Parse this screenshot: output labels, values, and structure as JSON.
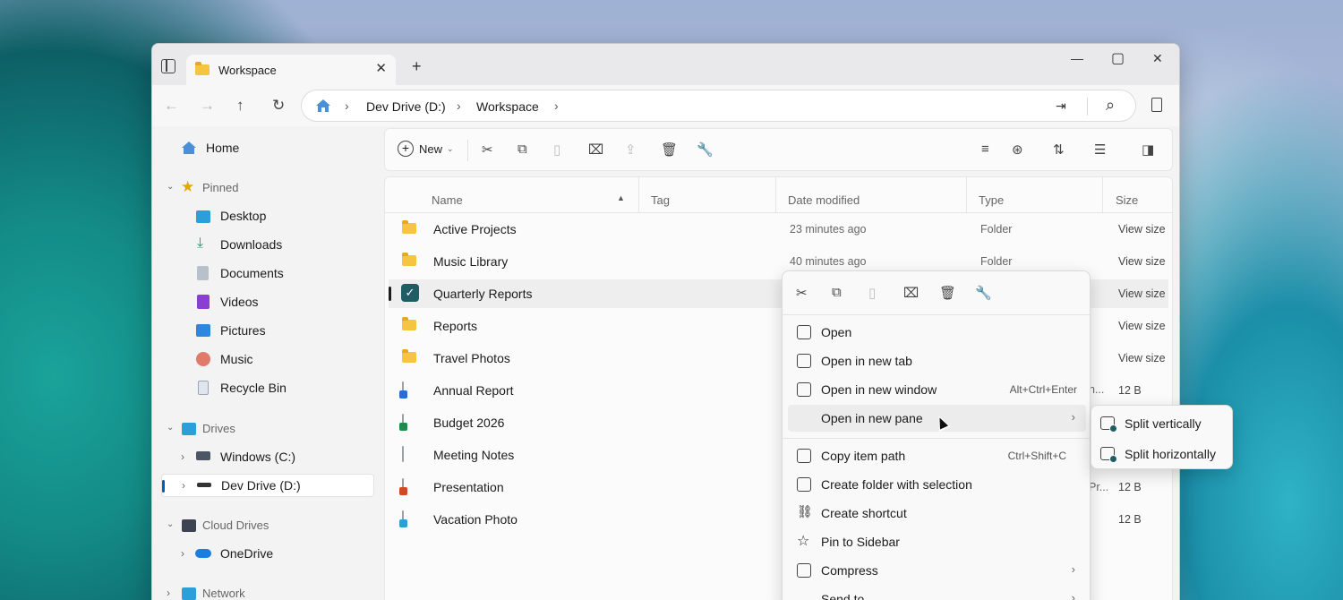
{
  "tab": {
    "title": "Workspace",
    "close": "✕",
    "new": "+"
  },
  "window_controls": {
    "minimize": "—",
    "maximize": "▢",
    "close": "✕"
  },
  "nav": {
    "back": "←",
    "forward": "→",
    "up": "↑",
    "refresh": "↻"
  },
  "breadcrumb": {
    "sep": "›",
    "items": [
      "Dev Drive (D:)",
      "Workspace"
    ]
  },
  "address_actions": {
    "expand": "⇥",
    "search": "⌕"
  },
  "sidebar": {
    "home": "Home",
    "pinned_label": "Pinned",
    "pinned": [
      "Desktop",
      "Downloads",
      "Documents",
      "Videos",
      "Pictures",
      "Music",
      "Recycle Bin"
    ],
    "drives_label": "Drives",
    "drives": [
      "Windows (C:)",
      "Dev Drive (D:)"
    ],
    "cloud_label": "Cloud Drives",
    "cloud": [
      "OneDrive"
    ],
    "network_label": "Network"
  },
  "toolbar": {
    "new_label": "New"
  },
  "columns": {
    "name": "Name",
    "tag": "Tag",
    "date": "Date modified",
    "type": "Type",
    "size": "Size"
  },
  "files": [
    {
      "name": "Active Projects",
      "date": "23 minutes ago",
      "type": "Folder",
      "size": "View size"
    },
    {
      "name": "Music Library",
      "date": "40 minutes ago",
      "type": "Folder",
      "size": "View size"
    },
    {
      "name": "Quarterly Reports",
      "date": "",
      "type": "",
      "size": "View size"
    },
    {
      "name": "Reports",
      "date": "",
      "type": "",
      "size": "View size"
    },
    {
      "name": "Travel Photos",
      "date": "",
      "type": "",
      "size": "View size"
    },
    {
      "name": "Annual Report",
      "date": "",
      "type": "",
      "size": "12 B",
      "type_clip": "n..."
    },
    {
      "name": "Budget 2026",
      "date": "",
      "type": "",
      "size": ""
    },
    {
      "name": "Meeting Notes",
      "date": "",
      "type": "",
      "size": ""
    },
    {
      "name": "Presentation",
      "date": "",
      "type": "",
      "size": "12 B",
      "type_clip": "Pr..."
    },
    {
      "name": "Vacation Photo",
      "date": "",
      "type": "",
      "size": "12 B"
    }
  ],
  "context_menu": {
    "items": [
      {
        "label": "Open",
        "shortcut": ""
      },
      {
        "label": "Open in new tab",
        "shortcut": ""
      },
      {
        "label": "Open in new window",
        "shortcut": "Alt+Ctrl+Enter"
      },
      {
        "label": "Open in new pane",
        "shortcut": ""
      },
      {
        "label": "Copy item path",
        "shortcut": "Ctrl+Shift+C"
      },
      {
        "label": "Create folder with selection",
        "shortcut": ""
      },
      {
        "label": "Create shortcut",
        "shortcut": ""
      },
      {
        "label": "Pin to Sidebar",
        "shortcut": ""
      },
      {
        "label": "Compress",
        "shortcut": ""
      },
      {
        "label": "Send to",
        "shortcut": ""
      }
    ],
    "arrow": "›"
  },
  "submenu": {
    "items": [
      "Split vertically",
      "Split horizontally"
    ]
  },
  "colors": {
    "accent": "#005fb8",
    "folder": "#f5c542",
    "check": "#1f5c63"
  }
}
